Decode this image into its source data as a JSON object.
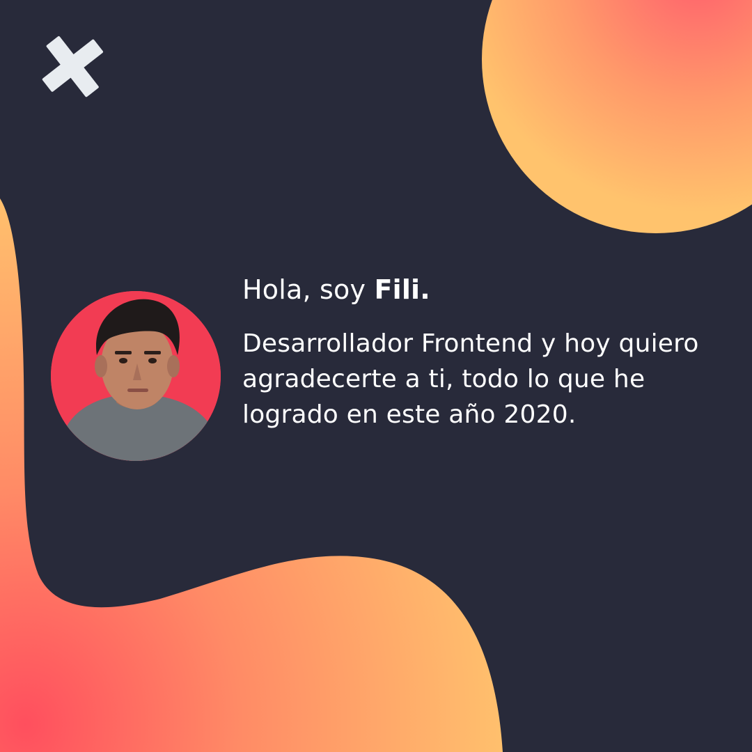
{
  "greeting": {
    "prefix": "Hola, soy ",
    "name": "Fili."
  },
  "bio": "Desarrollador Frontend y hoy quiero agradecerte a ti, todo lo que he logrado en este año 2020.",
  "colors": {
    "background": "#282a3a",
    "blob_orange": "#ffbf6b",
    "blob_coral": "#ff4f5e",
    "avatar_bg": "#f23c53",
    "plus_icon": "#e8ecf0"
  },
  "icons": {
    "decor": "plus-icon"
  }
}
